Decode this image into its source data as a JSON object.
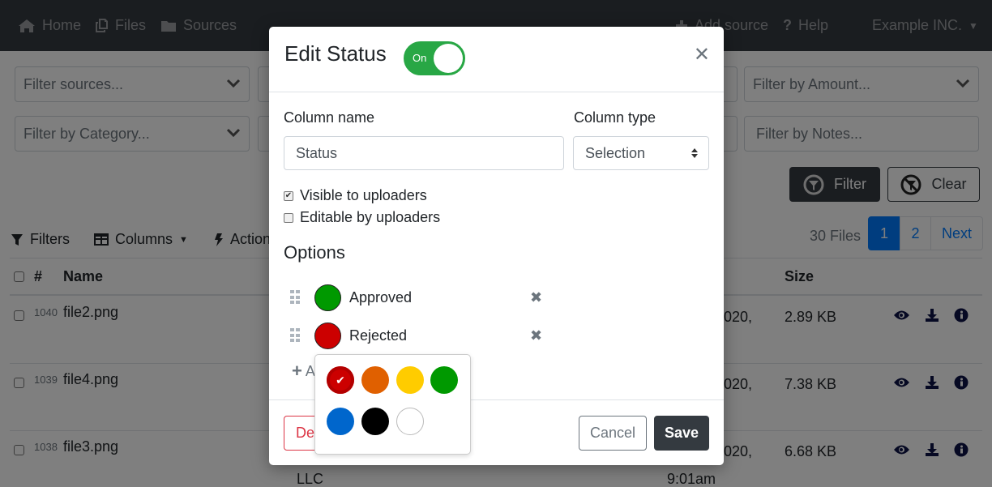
{
  "navbar": {
    "left": [
      {
        "label": "Home",
        "icon": "home-icon"
      },
      {
        "label": "Files",
        "icon": "files-icon"
      },
      {
        "label": "Sources",
        "icon": "folder-icon"
      }
    ],
    "add_source": "Add source",
    "help": "Help",
    "org": "Example INC."
  },
  "filters": {
    "sources_placeholder": "Filter sources...",
    "category_placeholder": "Filter by Category...",
    "amount_placeholder": "Filter by Amount...",
    "notes_placeholder": "Filter by Notes...",
    "filter_button": "Filter",
    "clear_button": "Clear"
  },
  "toolbar": {
    "filters": "Filters",
    "columns": "Columns",
    "actions": "Actions"
  },
  "pagination": {
    "count_label": "30 Files",
    "pages": [
      "1",
      "2"
    ],
    "active_page": "1",
    "next": "Next"
  },
  "table": {
    "headers": {
      "hash": "#",
      "name": "Name",
      "size": "Size"
    },
    "rows": [
      {
        "id": "1040",
        "name": "file2.png",
        "date_fragment": "020,",
        "size": "2.89 KB"
      },
      {
        "id": "1039",
        "name": "file4.png",
        "date_fragment": "020,",
        "size": "7.38 KB"
      },
      {
        "id": "1038",
        "name": "file3.png",
        "date_fragment": "020,",
        "size": "6.68 KB"
      }
    ],
    "footer_fragments": {
      "source": "LLC",
      "time": "9:01am"
    }
  },
  "modal": {
    "title": "Edit Status",
    "toggle_label": "On",
    "toggle_on": true,
    "column_name_label": "Column name",
    "column_name_value": "Status",
    "column_type_label": "Column type",
    "column_type_value": "Selection",
    "visible_label": "Visible to uploaders",
    "visible_checked": true,
    "editable_label": "Editable by uploaders",
    "editable_checked": false,
    "options_title": "Options",
    "options": [
      {
        "label": "Approved",
        "color": "#009900"
      },
      {
        "label": "Rejected",
        "color": "#cc0000"
      }
    ],
    "add_option": "Add option",
    "delete_button": "Delete",
    "cancel_button": "Cancel",
    "save_button": "Save"
  },
  "color_picker": {
    "selected": "#cc0000",
    "colors": [
      "#cc0000",
      "#e06000",
      "#ffcc00",
      "#009900",
      "#0066cc",
      "#000000",
      "#ffffff"
    ]
  }
}
